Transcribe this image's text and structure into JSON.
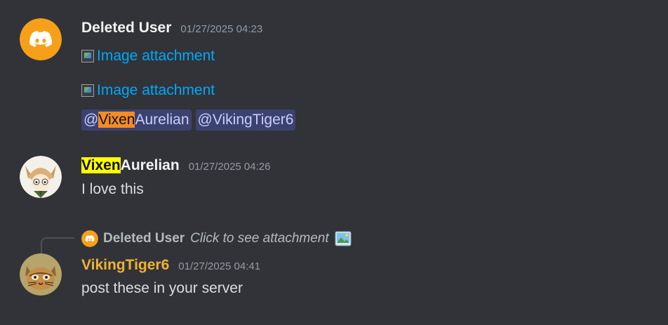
{
  "messages": [
    {
      "author": "Deleted User",
      "timestamp": "01/27/2025 04:23",
      "attachments": [
        "Image attachment",
        "Image attachment"
      ],
      "mentions": [
        {
          "prefix": "@",
          "highlight": "Vixen",
          "rest": "Aurelian"
        },
        {
          "full": "@VikingTiger6"
        }
      ]
    },
    {
      "author_highlight": "Vixen",
      "author_rest": "Aurelian",
      "timestamp": "01/27/2025 04:26",
      "content": "I love this"
    },
    {
      "reply": {
        "author": "Deleted User",
        "text": "Click to see attachment"
      },
      "author": "VikingTiger6",
      "timestamp": "01/27/2025 04:41",
      "content": "post these in your server"
    }
  ],
  "colors": {
    "background": "#313338",
    "link": "#00a8fc",
    "mention_bg": "#3c4270",
    "highlight_orange": "#f48c26",
    "highlight_yellow": "#ffff00",
    "username_gold": "#f0b232",
    "discord_orange": "#f6a01a"
  },
  "icons": {
    "avatar_1": "discord-logo-icon",
    "avatar_2": "cat-girl-avatar",
    "avatar_3": "cat-painting-avatar",
    "reply_image": "image-emoji-icon"
  }
}
